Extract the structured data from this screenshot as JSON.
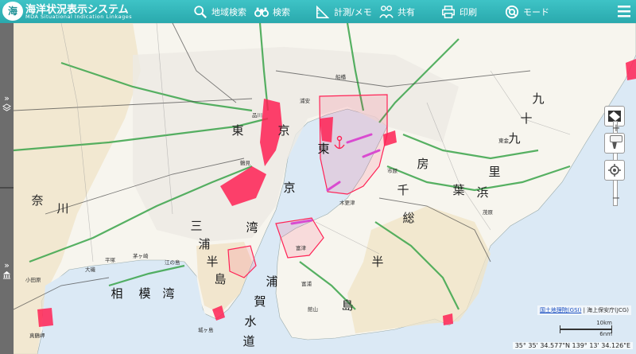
{
  "header": {
    "title": "海洋状況表示システム",
    "subtitle": "MDA Situational Indication Linkages",
    "logo_text": "海",
    "tools": [
      {
        "label": "地域検索",
        "icon": "search-icon"
      },
      {
        "label": "検索",
        "icon": "binoculars-icon"
      },
      {
        "label": "計測/メモ",
        "icon": "ruler-icon"
      },
      {
        "label": "共有",
        "icon": "share-icon"
      },
      {
        "label": "印刷",
        "icon": "printer-icon"
      },
      {
        "label": "モード",
        "icon": "lifebuoy-icon"
      }
    ]
  },
  "sidebar": {
    "expand_symbol": "»"
  },
  "map_labels": {
    "tokyo_1": "東",
    "tokyo_2": "京",
    "kanagawa_1": "奈",
    "kanagawa_2": "川",
    "miura_1": "三",
    "miura_2": "浦",
    "miura_3": "半",
    "miura_4": "島",
    "tokyo_bay_1": "東",
    "tokyo_bay_2": "京",
    "tokyo_bay_3": "湾",
    "boso_1": "房",
    "boso_2": "総",
    "boso_3": "半",
    "boso_4": "島",
    "chiba_1": "千",
    "chiba_2": "葉",
    "sagami_1": "相",
    "sagami_2": "模",
    "sagami_3": "湾",
    "uraga_1": "浦",
    "uraga_2": "賀",
    "uraga_3": "水",
    "uraga_4": "道",
    "kujukuri": [
      "九",
      "十",
      "九",
      "里",
      "浜"
    ],
    "enoshima": "江の島",
    "jogashima": "城ヶ島",
    "tateyama": "館山",
    "tomiura": "富浦",
    "futtsu": "富津",
    "kisarazu": "木更津",
    "ichihara": "市原",
    "mobara": "茂原",
    "togane": "東金",
    "tsurumi": "鶴見",
    "oiso": "大磯",
    "hiratsuka": "平塚",
    "shinagawa": "品川",
    "urayasu": "浦安",
    "funabashi": "船橋",
    "chigasaki": "茅ヶ崎",
    "manazuru": "真鶴岬",
    "odawara": "小田原"
  },
  "attribution": {
    "gsi_link": "国土地理院(GSI)",
    "separator": " | ",
    "jcg": "海上保安庁(JCG)"
  },
  "scale": {
    "km": "10km",
    "nm": "6nm"
  },
  "coordinates": "35° 35' 34.577\"N 139° 13' 34.126\"E",
  "colors": {
    "header": "#2fb3b7",
    "sea": "#dbe9f5",
    "zone": "#ff2255",
    "road": "#3aa44a"
  }
}
